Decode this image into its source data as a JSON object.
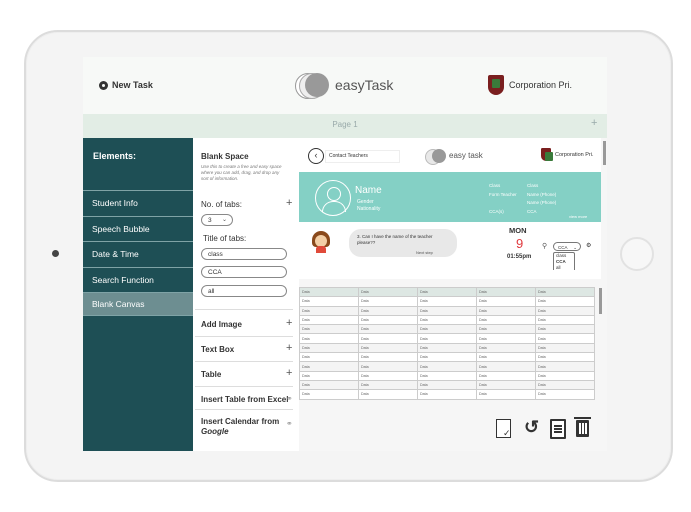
{
  "app": {
    "new_task_label": "New Task",
    "logo_text": "easyTask",
    "school_name": "Corporation Pri.",
    "page_label": "Page 1",
    "add_page": "+"
  },
  "sidebar": {
    "heading": "Elements:",
    "items": [
      {
        "label": "Student Info"
      },
      {
        "label": "Speech Bubble"
      },
      {
        "label": "Date & Time"
      },
      {
        "label": "Search Function"
      },
      {
        "label": "Blank Canvas"
      }
    ]
  },
  "panel": {
    "title": "Blank Space",
    "description": "Use this to create a free and easy space where you can add, drag, and drop any sort of information.",
    "tabs_count_label": "No. of tabs:",
    "tabs_count_value": "3",
    "tab_titles_label": "Title of tabs:",
    "tab_titles": [
      "class",
      "CCA",
      "all"
    ],
    "add_image": "Add Image",
    "text_box": "Text Box",
    "table": "Table",
    "insert_excel": "Insert Table from Excel",
    "insert_calendar": "Insert Calendar from",
    "insert_calendar_source": "Google",
    "plus": "+"
  },
  "canvas": {
    "contact_label": "Contact Teachers",
    "logo_text": "easy task",
    "school_name": "Corporation Pri.",
    "profile": {
      "name": "Name",
      "gender": "Gender",
      "nationality": "Nationality",
      "field_labels": [
        "Class",
        "Form Teacher",
        "",
        "CCA(s)"
      ],
      "field_values": [
        "Class",
        "Name (Phone)",
        "Name (Phone)",
        "CCA"
      ],
      "more": "view more"
    },
    "bubble_text": "3. Can I have the name of the teacher please??",
    "bubble_next": "Next step",
    "day": "MON",
    "date": "9",
    "time": "01:55pm",
    "filter_value": "CCA",
    "filter_options": [
      "class",
      "CCA",
      "all"
    ],
    "table_cell": "Data",
    "colors": {
      "teal": "#84d0c5",
      "sidebar": "#1e4f55",
      "date_red": "#e0393e"
    }
  },
  "toolbar_icons": [
    "clipboard-check-icon",
    "undo-icon",
    "copy-icon",
    "trash-icon"
  ]
}
